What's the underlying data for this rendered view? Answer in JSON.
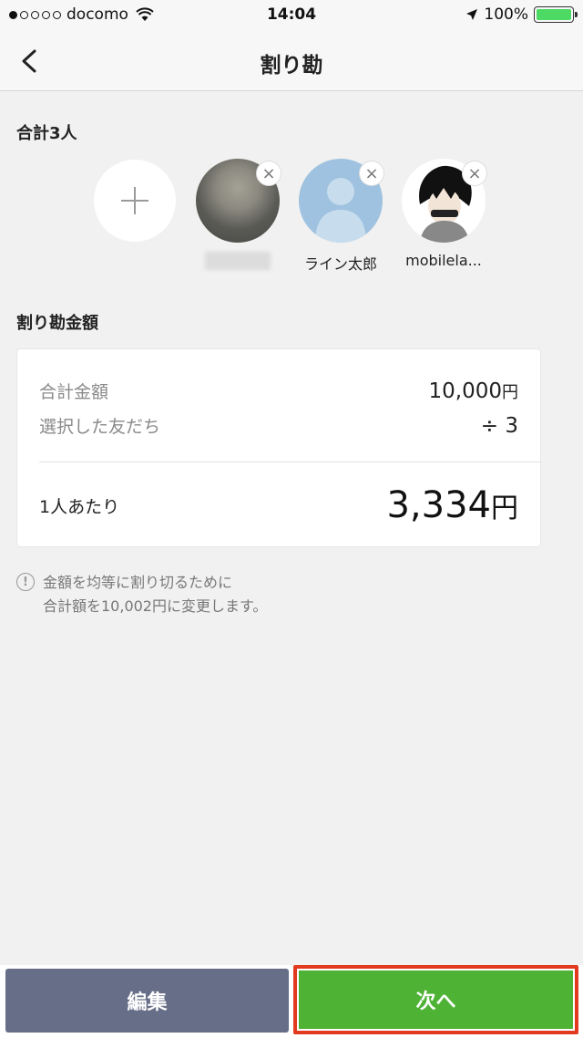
{
  "status_bar": {
    "carrier": "docomo",
    "time": "14:04",
    "battery": "100%"
  },
  "nav": {
    "title": "割り勘"
  },
  "members": {
    "title": "合計3人",
    "list": [
      {
        "name": "",
        "avatar": "blurred-photo"
      },
      {
        "name": "ライン太郎",
        "avatar": "default-person"
      },
      {
        "name": "mobilela...",
        "avatar": "anime-character"
      }
    ]
  },
  "amount": {
    "title": "割り勘金額",
    "total_label": "合計金額",
    "total_value": "10,000",
    "yen": "円",
    "friends_label": "選択した友だち",
    "friends_value": "÷ 3",
    "per_person_label": "1人あたり",
    "per_person_value": "3,334"
  },
  "notice": {
    "line1": "金額を均等に割り切るために",
    "line2": "合計額を10,002円に変更します。"
  },
  "buttons": {
    "edit": "編集",
    "next": "次へ"
  },
  "colors": {
    "edit_button": "#676e87",
    "next_button": "#4eb334",
    "highlight_border": "#e23a1e"
  }
}
